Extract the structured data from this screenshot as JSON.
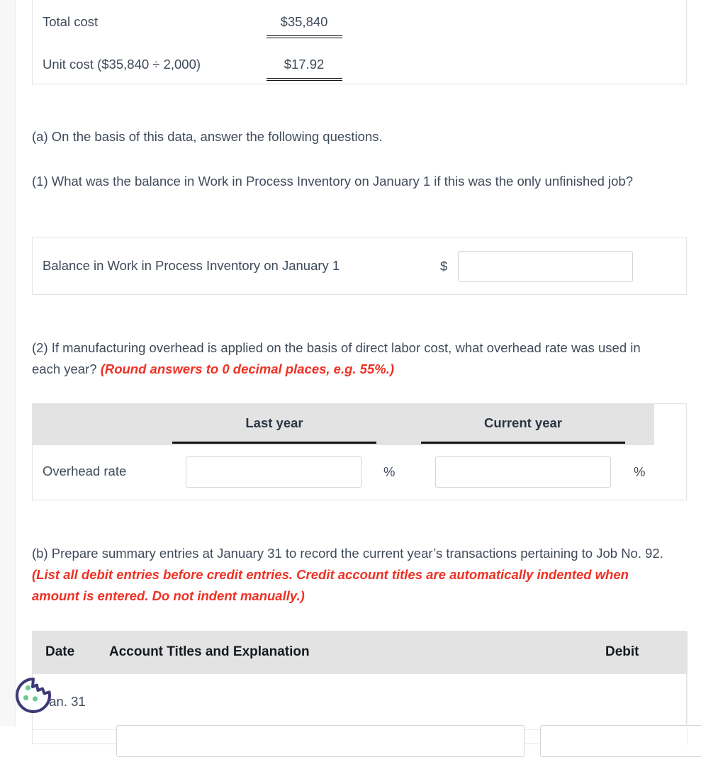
{
  "cost_table": {
    "rows": [
      {
        "label": "Total cost",
        "value": "$35,840"
      },
      {
        "label": "Unit cost ($35,840 ÷ 2,000)",
        "value": "$17.92"
      }
    ]
  },
  "question_a": {
    "intro": "(a) On the basis of this data, answer the following questions.",
    "q1": "(1) What was the balance in Work in Process Inventory on January 1 if this was the only unfinished job?"
  },
  "balance_table": {
    "label": "Balance in Work in Process Inventory on January 1",
    "currency_symbol": "$",
    "input_value": "",
    "input_placeholder": ""
  },
  "question_a2": {
    "text_plain": "(2) If manufacturing overhead is applied on the basis of direct labor cost, what overhead rate was used in each year? ",
    "text_red": "(Round answers to 0 decimal places, e.g. 55%.)"
  },
  "overhead_table": {
    "headers": [
      "Last year",
      "Current year"
    ],
    "row_label": "Overhead rate",
    "last_year_value": "",
    "current_year_value": "",
    "unit_suffix": "%"
  },
  "question_b": {
    "text_plain_1": "(b) Prepare summary entries at January 31 to record the current year’s transactions pertaining to Job No. 92. ",
    "text_red": "(List all debit entries before credit entries. Credit account titles are automatically indented when amount is entered. Do not indent manually.)"
  },
  "journal_table": {
    "headers": {
      "date": "Date",
      "account": "Account Titles and Explanation",
      "debit": "Debit"
    },
    "rows": [
      {
        "date": "Jan. 31",
        "account_value": "",
        "debit_value": ""
      }
    ]
  },
  "cookie_widget": {
    "name": "cookie-consent-icon",
    "outline_color": "#3d3a77",
    "dot_color": "#6cc894"
  },
  "colors": {
    "body_text": "#3f4a5a",
    "red_instruction": "#ee3124",
    "table_header_bg": "#e3e3e3",
    "table_border": "#e3e3e3",
    "input_border": "#d5d5d5",
    "page_gutter": "#f7f7f7"
  }
}
